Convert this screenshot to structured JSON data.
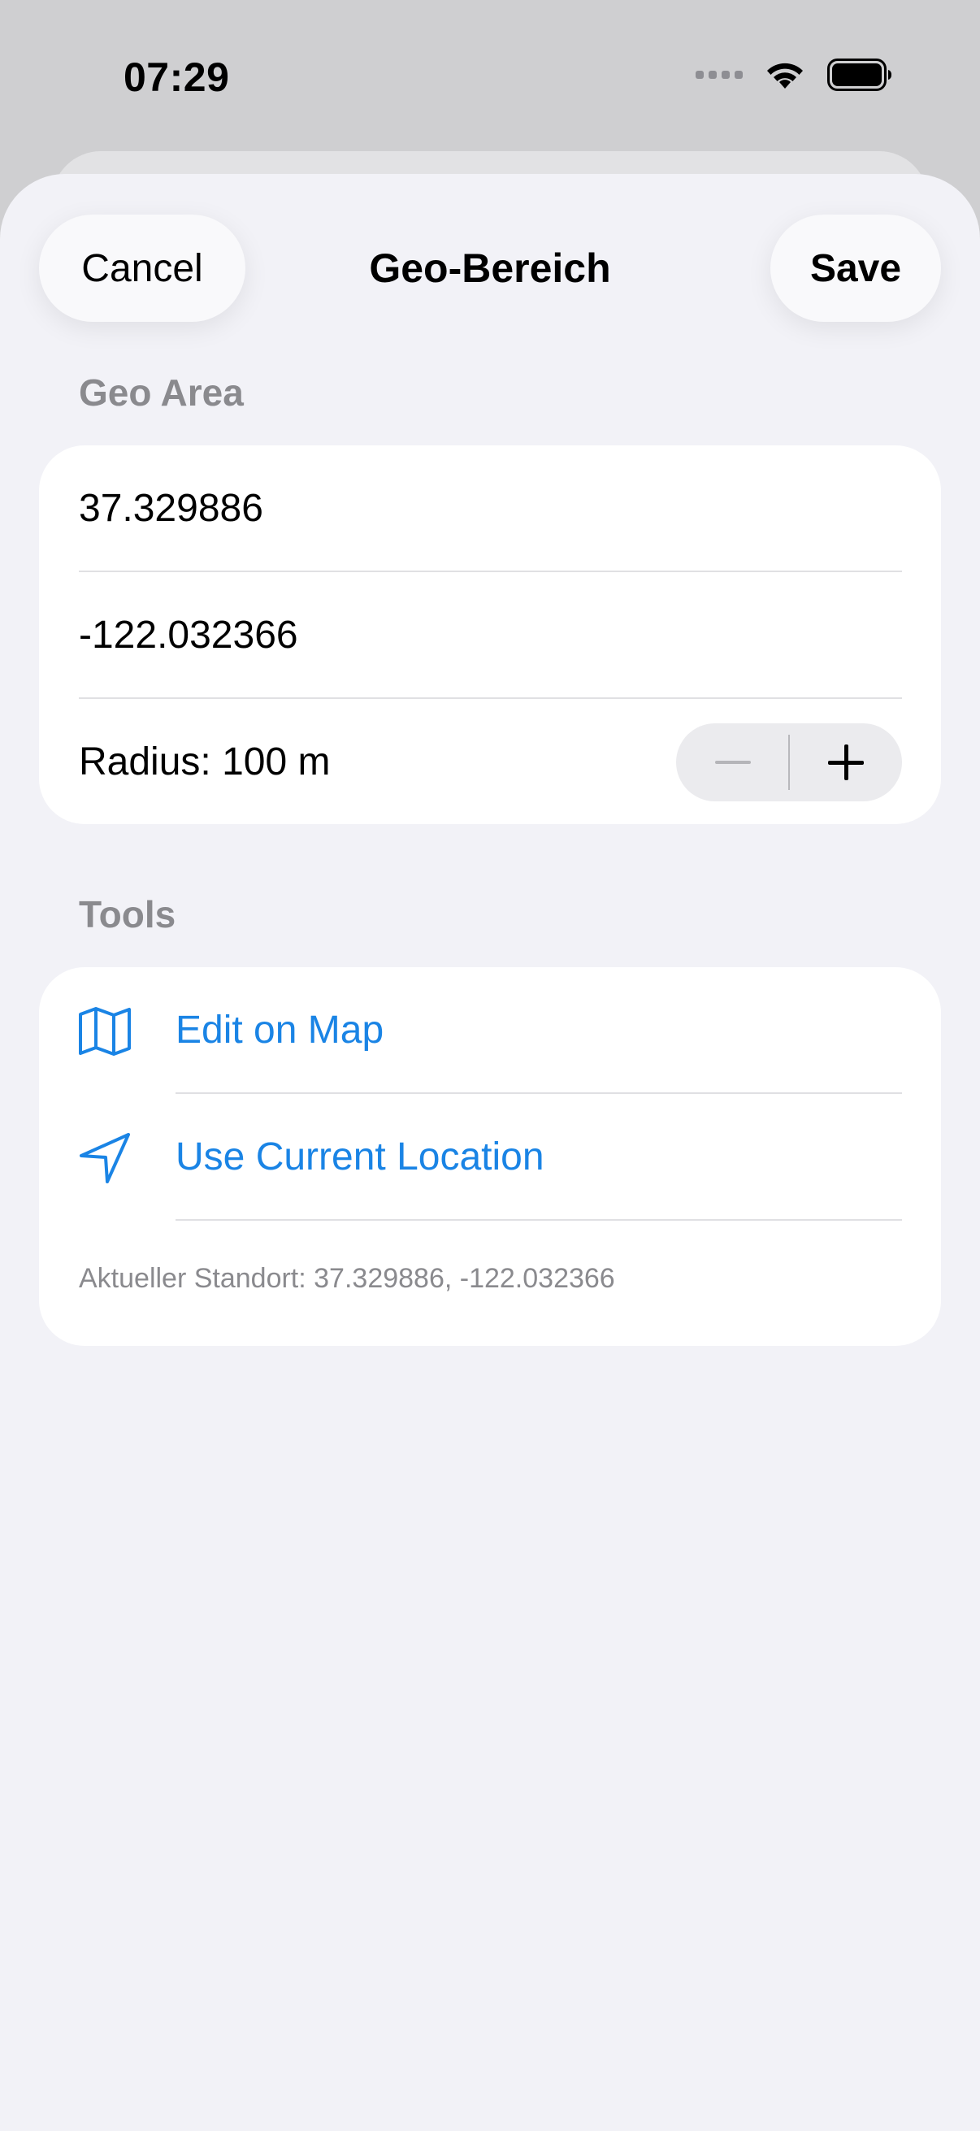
{
  "status_bar": {
    "time": "07:29"
  },
  "nav": {
    "cancel_label": "Cancel",
    "title": "Geo-Bereich",
    "save_label": "Save"
  },
  "geo_area": {
    "header": "Geo Area",
    "latitude": "37.329886",
    "longitude": "-122.032366",
    "radius_label": "Radius: 100 m"
  },
  "tools": {
    "header": "Tools",
    "edit_on_map_label": "Edit on Map",
    "edit_on_map_icon": "map-icon",
    "use_current_location_label": "Use Current Location",
    "use_current_location_icon": "location-arrow-icon",
    "current_location_note": "Aktueller Standort: 37.329886, -122.032366"
  },
  "colors": {
    "accent": "#1a84e5",
    "background": "#f2f2f7",
    "secondary_text": "#8a8a8e"
  }
}
